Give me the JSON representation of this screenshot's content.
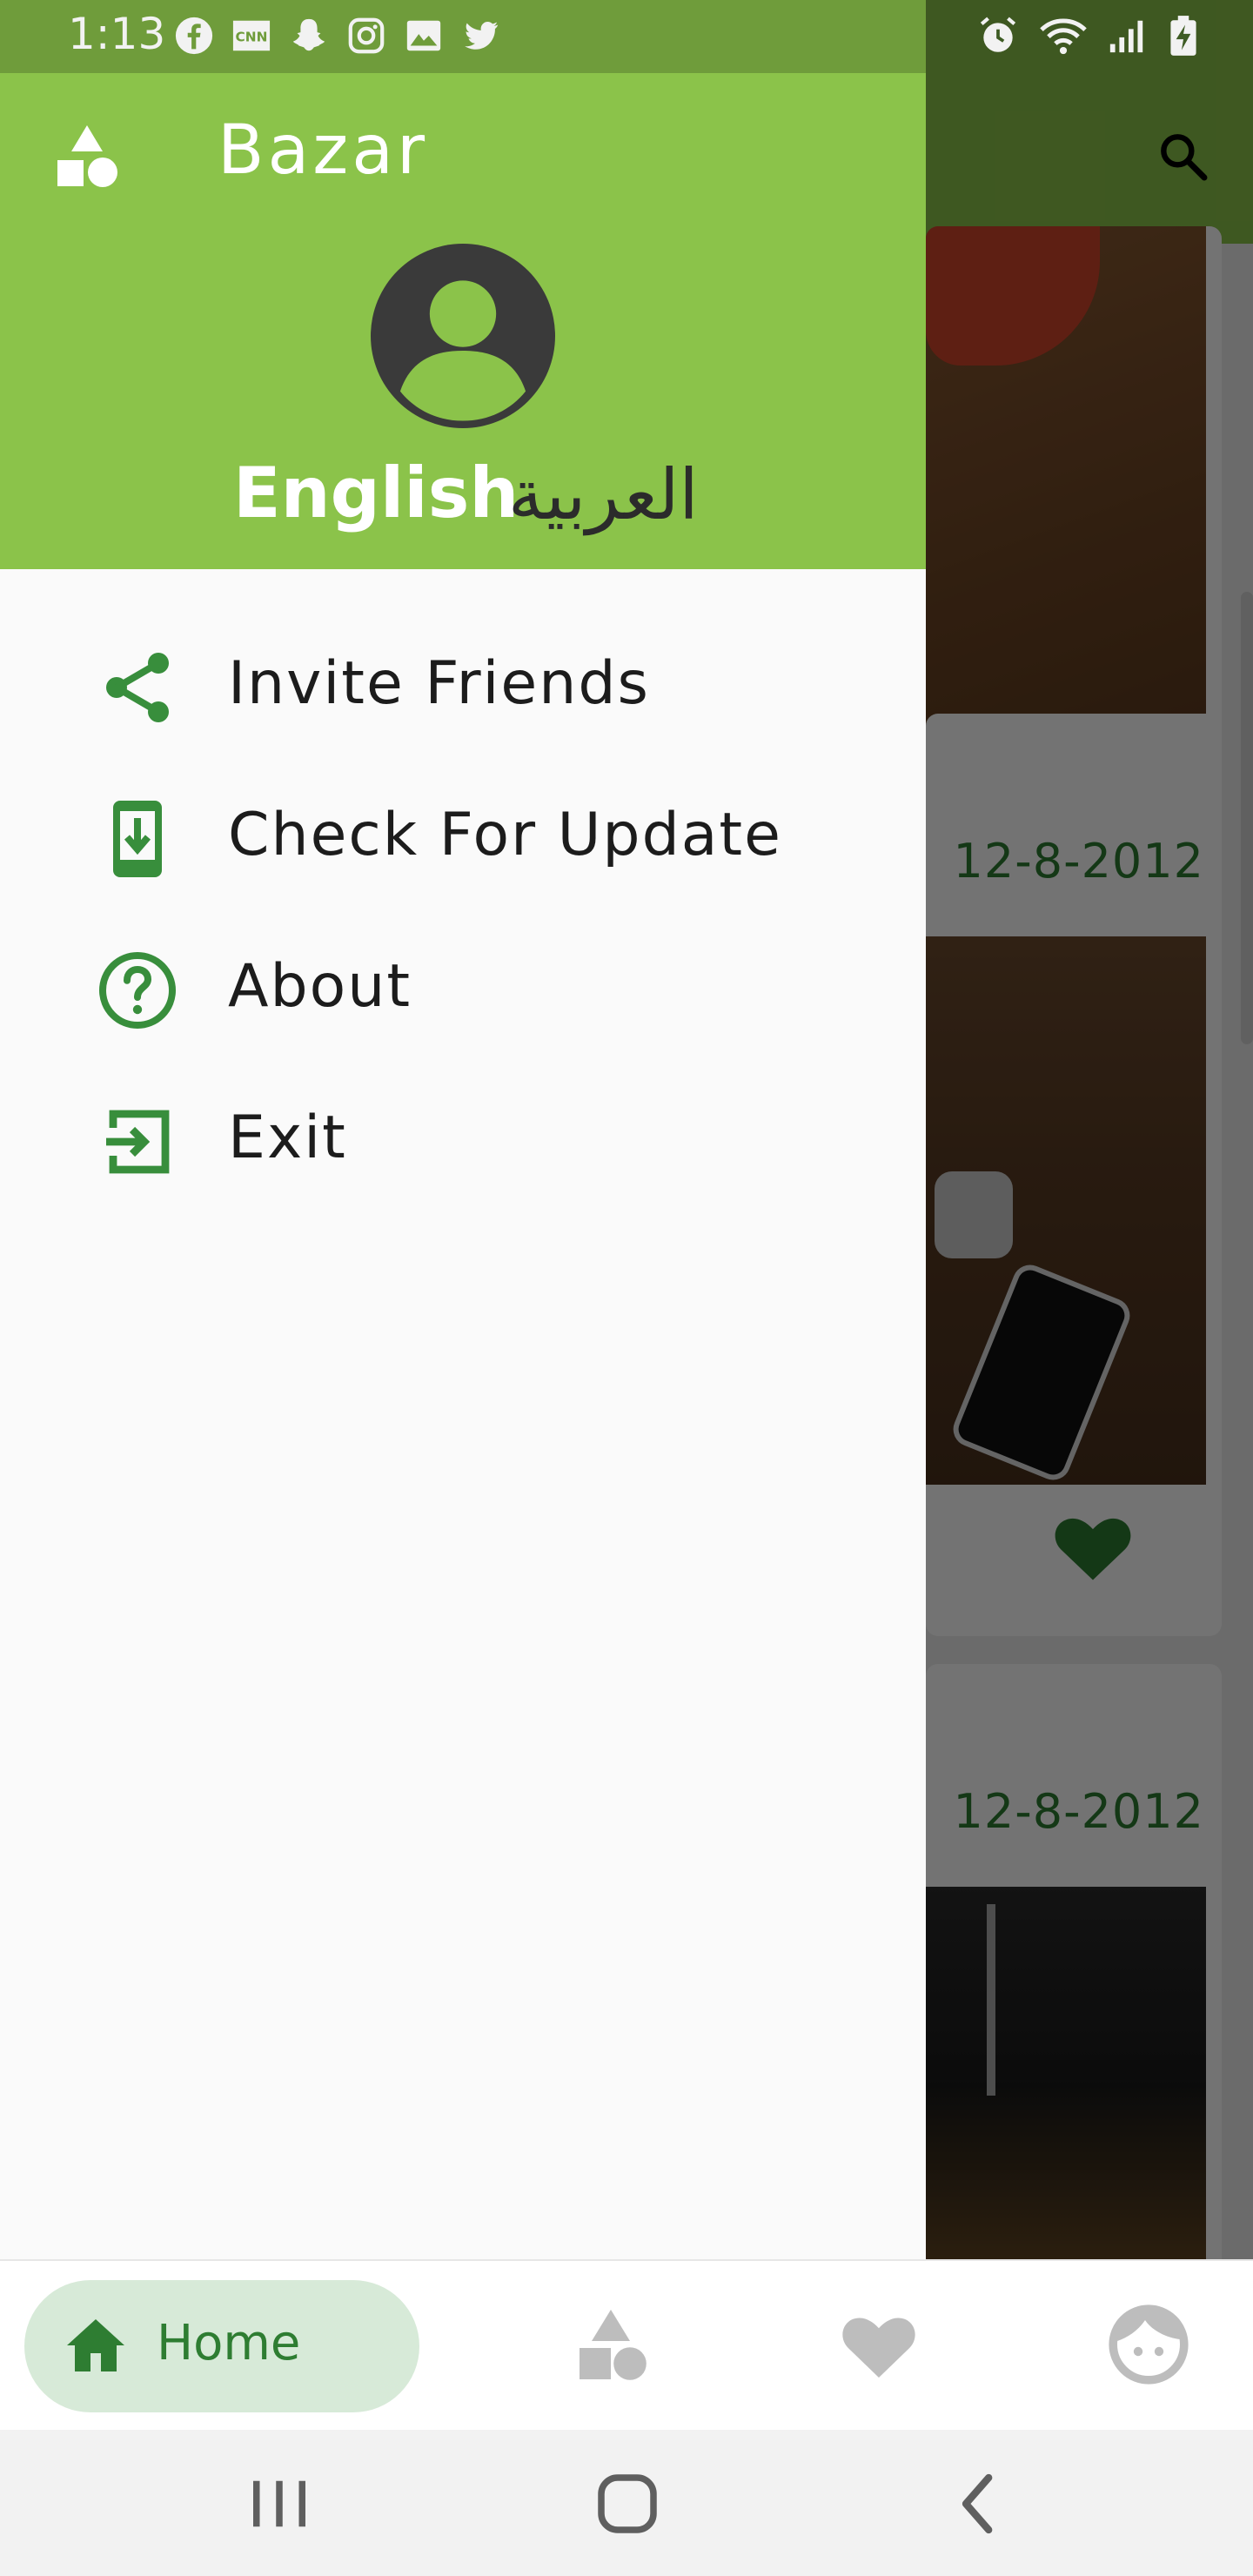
{
  "status_bar": {
    "time": "1:13",
    "notification_icons": [
      "facebook-icon",
      "cnn-icon",
      "snapchat-icon",
      "instagram-icon",
      "gallery-icon",
      "twitter-icon"
    ],
    "system_icons": [
      "alarm-icon",
      "wifi-icon",
      "signal-icon",
      "battery-charging-icon"
    ]
  },
  "drawer": {
    "title": "Bazar",
    "logo_icon": "shapes-icon",
    "avatar_icon": "account-circle-icon",
    "languages": {
      "english": "English",
      "arabic": "العربية"
    },
    "menu_items": [
      {
        "label": "Invite Friends",
        "icon": "share-icon"
      },
      {
        "label": "Check For Update",
        "icon": "download-update-icon"
      },
      {
        "label": "About",
        "icon": "help-circle-icon"
      },
      {
        "label": "Exit",
        "icon": "exit-icon"
      }
    ]
  },
  "background_feed": {
    "search_icon": "search-icon",
    "cards": [
      {
        "date": "",
        "favorited": false
      },
      {
        "date": "12-8-2012",
        "favorited": true
      },
      {
        "date": "12-8-2012",
        "favorited": false
      }
    ]
  },
  "bottom_nav": {
    "items": [
      {
        "label": "Home",
        "icon": "home-icon",
        "active": true
      },
      {
        "label": "",
        "icon": "categories-icon",
        "active": false
      },
      {
        "label": "",
        "icon": "heart-icon",
        "active": false
      },
      {
        "label": "",
        "icon": "profile-face-icon",
        "active": false
      }
    ]
  },
  "system_nav": [
    "recents-icon",
    "home-circle-icon",
    "back-icon"
  ],
  "colors": {
    "primary": "#8bc34a",
    "primary_dark": "#6f9c3b",
    "accent_green": "#2e7d32",
    "icon_green": "#388e3c",
    "home_pill": "#d7ead8"
  }
}
